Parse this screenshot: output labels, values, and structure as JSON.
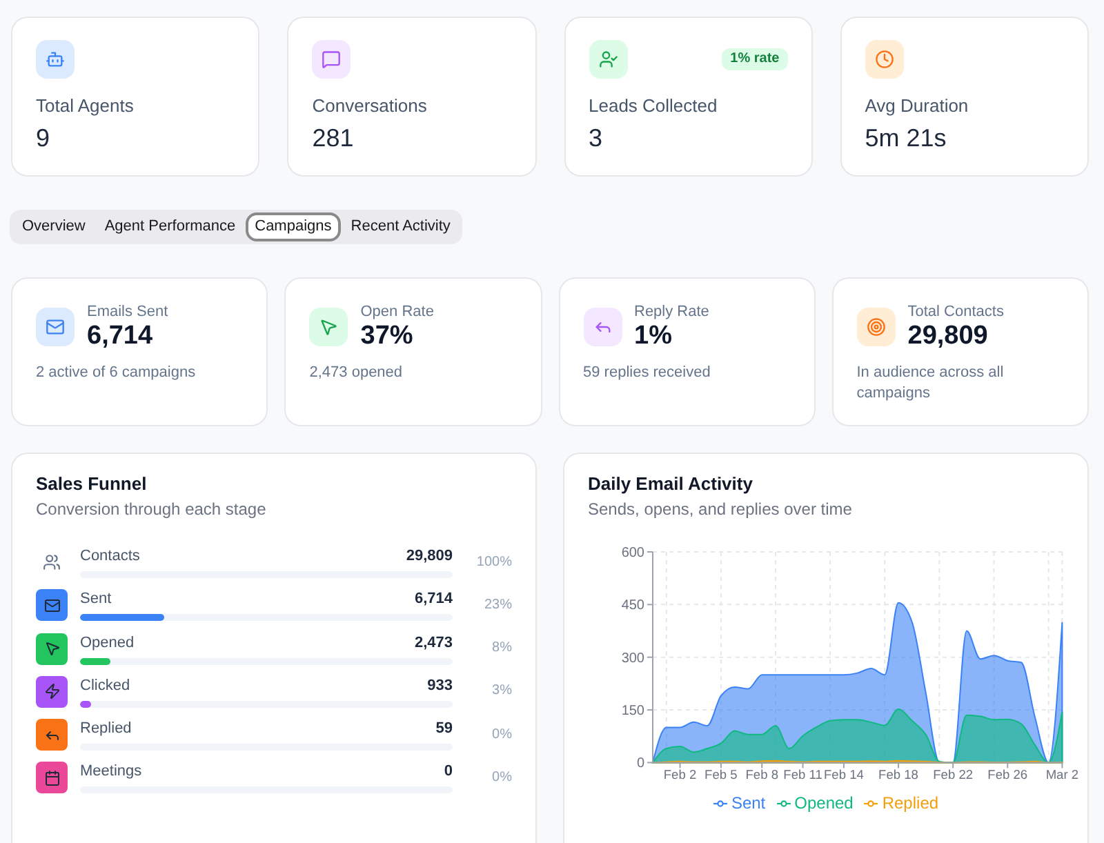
{
  "summary_cards": [
    {
      "label": "Total Agents",
      "value": "9"
    },
    {
      "label": "Conversations",
      "value": "281"
    },
    {
      "label": "Leads Collected",
      "value": "3",
      "badge": "1% rate"
    },
    {
      "label": "Avg Duration",
      "value": "5m 21s"
    }
  ],
  "tabs": [
    {
      "label": "Overview",
      "selected": false
    },
    {
      "label": "Agent Performance",
      "selected": false
    },
    {
      "label": "Campaigns",
      "selected": true
    },
    {
      "label": "Recent Activity",
      "selected": false
    }
  ],
  "campaign_stats": [
    {
      "label": "Emails Sent",
      "value": "6,714",
      "detail": "2 active of 6 campaigns"
    },
    {
      "label": "Open Rate",
      "value": "37%",
      "detail": "2,473 opened"
    },
    {
      "label": "Reply Rate",
      "value": "1%",
      "detail": "59 replies received"
    },
    {
      "label": "Total Contacts",
      "value": "29,809",
      "detail": "In audience across all campaigns"
    }
  ],
  "sales_funnel": {
    "title": "Sales Funnel",
    "subtitle": "Conversion through each stage",
    "stages": [
      {
        "kind": "total",
        "label": "Contacts",
        "value": "29,809",
        "percent": "100%"
      },
      {
        "kind": "stage",
        "label": "Sent",
        "value": "6,714",
        "level": 0.225,
        "percent": "23%",
        "color": "#3b82f6"
      },
      {
        "kind": "stage",
        "label": "Opened",
        "value": "2,473",
        "level": 0.083,
        "percent": "8%",
        "color": "#22c55e"
      },
      {
        "kind": "stage",
        "label": "Clicked",
        "value": "933",
        "level": 0.031,
        "percent": "3%",
        "color": "#a855f7"
      },
      {
        "kind": "stage",
        "label": "Replied",
        "value": "59",
        "percent": "0%",
        "color": "#f97316"
      },
      {
        "kind": "stage",
        "label": "Meetings",
        "value": "0",
        "percent": "0%",
        "color": "#ec4899"
      }
    ]
  },
  "email_activity": {
    "title": "Daily Email Activity",
    "subtitle": "Sends, opens, and replies over time",
    "chart_data": {
      "type": "area",
      "categories": [
        null,
        null,
        "Feb 2",
        null,
        null,
        "Feb 5",
        null,
        null,
        "Feb 8",
        null,
        null,
        "Feb 11",
        null,
        null,
        "Feb 14",
        null,
        null,
        null,
        "Feb 18",
        null,
        null,
        null,
        "Feb 22",
        null,
        null,
        null,
        "Feb 26",
        null,
        null,
        null,
        "Mar 2"
      ],
      "series": [
        {
          "name": "Sent",
          "color": "#3b82f6",
          "values": [
            0,
            100,
            100,
            115,
            105,
            190,
            215,
            210,
            250,
            250,
            250,
            250,
            250,
            250,
            250,
            255,
            268,
            250,
            455,
            400,
            200,
            0,
            0,
            375,
            295,
            305,
            290,
            285,
            130,
            0,
            400
          ]
        },
        {
          "name": "Opened",
          "color": "#10b981",
          "values": [
            0,
            40,
            46,
            30,
            40,
            55,
            90,
            80,
            80,
            105,
            40,
            76,
            101,
            119,
            122,
            122,
            115,
            106,
            152,
            119,
            80,
            3,
            0,
            135,
            132,
            122,
            123,
            110,
            50,
            0,
            145
          ]
        },
        {
          "name": "Replied",
          "color": "#f59e0b",
          "values": [
            0,
            2,
            3,
            2,
            2,
            3,
            3,
            2,
            4,
            5,
            3,
            2,
            3,
            3,
            3,
            3,
            4,
            3,
            5,
            4,
            3,
            1,
            0,
            2,
            2,
            1,
            1,
            2,
            3,
            0,
            1
          ]
        }
      ],
      "ylim": [
        0,
        600
      ],
      "yticks": [
        0,
        150,
        300,
        450,
        600
      ],
      "stacked": false,
      "grid": true,
      "legend": "bottom"
    }
  }
}
